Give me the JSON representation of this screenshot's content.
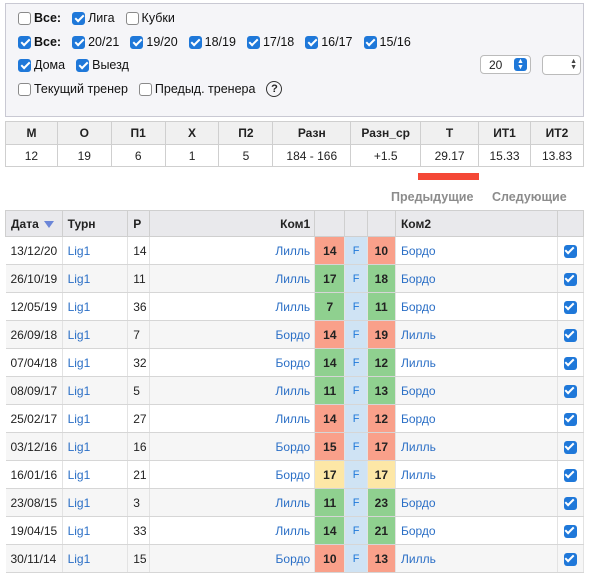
{
  "colors": {
    "win": "#8fd08f",
    "loss": "#f9a08a",
    "draw": "#fde7a6",
    "mid": "#cfe3f4",
    "accent": "#1f78d9"
  },
  "filters": {
    "row1": [
      {
        "label": "Все:",
        "checked": false,
        "bold": true
      },
      {
        "label": "Лига",
        "checked": true,
        "bold": false
      },
      {
        "label": "Кубки",
        "checked": false,
        "bold": false
      }
    ],
    "row2": [
      {
        "label": "Все:",
        "checked": true,
        "bold": true
      },
      {
        "label": "20/21",
        "checked": true,
        "bold": false
      },
      {
        "label": "19/20",
        "checked": true,
        "bold": false
      },
      {
        "label": "18/19",
        "checked": true,
        "bold": false
      },
      {
        "label": "17/18",
        "checked": true,
        "bold": false
      },
      {
        "label": "16/17",
        "checked": true,
        "bold": false
      },
      {
        "label": "15/16",
        "checked": true,
        "bold": false
      }
    ],
    "row3": [
      {
        "label": "Дома",
        "checked": true,
        "bold": false
      },
      {
        "label": "Выезд",
        "checked": true,
        "bold": false
      }
    ],
    "row4": [
      {
        "label": "Текущий тренер",
        "checked": false,
        "bold": false
      },
      {
        "label": "Предыд. тренера",
        "checked": false,
        "bold": false
      }
    ],
    "help": "?",
    "count_value": "20",
    "number_input_value": ""
  },
  "summary": {
    "headers": [
      "М",
      "О",
      "П1",
      "Х",
      "П2",
      "Разн",
      "Разн_ср",
      "Т",
      "ИТ1",
      "ИТ2"
    ],
    "values": [
      "12",
      "19",
      "6",
      "1",
      "5",
      "184 - 166",
      "+1.5",
      "29.17",
      "15.33",
      "13.83"
    ]
  },
  "pager": {
    "prev": "Предыдущие",
    "next": "Следующие"
  },
  "matches": {
    "headers": [
      "Дата",
      "Турн",
      "Р",
      "Ком1",
      "",
      "",
      "",
      "Ком2",
      ""
    ],
    "rows": [
      {
        "date": "13/12/20",
        "tour": "Lig1",
        "r": "14",
        "team1": "Лилль",
        "s1": "14",
        "ft": "F",
        "s2": "10",
        "team2": "Бордо",
        "res": "loss"
      },
      {
        "date": "26/10/19",
        "tour": "Lig1",
        "r": "11",
        "team1": "Лилль",
        "s1": "17",
        "ft": "F",
        "s2": "18",
        "team2": "Бордо",
        "res": "win"
      },
      {
        "date": "12/05/19",
        "tour": "Lig1",
        "r": "36",
        "team1": "Лилль",
        "s1": "7",
        "ft": "F",
        "s2": "11",
        "team2": "Бордо",
        "res": "win"
      },
      {
        "date": "26/09/18",
        "tour": "Lig1",
        "r": "7",
        "team1": "Бордо",
        "s1": "14",
        "ft": "F",
        "s2": "19",
        "team2": "Лилль",
        "res": "loss"
      },
      {
        "date": "07/04/18",
        "tour": "Lig1",
        "r": "32",
        "team1": "Бордо",
        "s1": "14",
        "ft": "F",
        "s2": "12",
        "team2": "Лилль",
        "res": "win"
      },
      {
        "date": "08/09/17",
        "tour": "Lig1",
        "r": "5",
        "team1": "Лилль",
        "s1": "11",
        "ft": "F",
        "s2": "13",
        "team2": "Бордо",
        "res": "win"
      },
      {
        "date": "25/02/17",
        "tour": "Lig1",
        "r": "27",
        "team1": "Лилль",
        "s1": "14",
        "ft": "F",
        "s2": "12",
        "team2": "Бордо",
        "res": "loss"
      },
      {
        "date": "03/12/16",
        "tour": "Lig1",
        "r": "16",
        "team1": "Бордо",
        "s1": "15",
        "ft": "F",
        "s2": "17",
        "team2": "Лилль",
        "res": "loss"
      },
      {
        "date": "16/01/16",
        "tour": "Lig1",
        "r": "21",
        "team1": "Бордо",
        "s1": "17",
        "ft": "F",
        "s2": "17",
        "team2": "Лилль",
        "res": "draw"
      },
      {
        "date": "23/08/15",
        "tour": "Lig1",
        "r": "3",
        "team1": "Лилль",
        "s1": "11",
        "ft": "F",
        "s2": "23",
        "team2": "Бордо",
        "res": "win"
      },
      {
        "date": "19/04/15",
        "tour": "Lig1",
        "r": "33",
        "team1": "Лилль",
        "s1": "14",
        "ft": "F",
        "s2": "21",
        "team2": "Бордо",
        "res": "win"
      },
      {
        "date": "30/11/14",
        "tour": "Lig1",
        "r": "15",
        "team1": "Бордо",
        "s1": "10",
        "ft": "F",
        "s2": "13",
        "team2": "Лилль",
        "res": "loss"
      }
    ]
  }
}
